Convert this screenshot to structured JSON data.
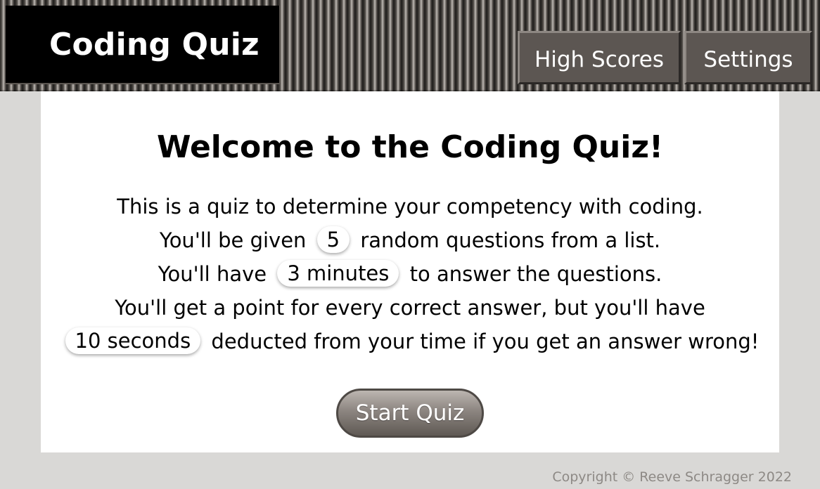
{
  "header": {
    "brand_title": "Coding Quiz",
    "nav": {
      "high_scores": "High Scores",
      "settings": "Settings"
    }
  },
  "main": {
    "welcome_title": "Welcome to the Coding Quiz!",
    "line1": "This is a quiz to determine your competency with coding.",
    "line2_before": "You'll be given",
    "question_count": "5",
    "line2_after": "random questions from a list.",
    "line3_before": "You'll have",
    "time_limit": "3 minutes",
    "line3_after": "to answer the questions.",
    "line4": "You'll get a point for every correct answer, but you'll have",
    "penalty": "10 seconds",
    "line5_after": "deducted from your time if you get an answer wrong!",
    "start_button": "Start Quiz"
  },
  "footer": {
    "copyright": "Copyright © Reeve Schragger 2022"
  },
  "colors": {
    "page_background": "#d9d8d6",
    "card_background": "#ffffff",
    "nav_button": "#5c5652",
    "brand_background": "#000000",
    "footer_text": "#8d8985"
  }
}
